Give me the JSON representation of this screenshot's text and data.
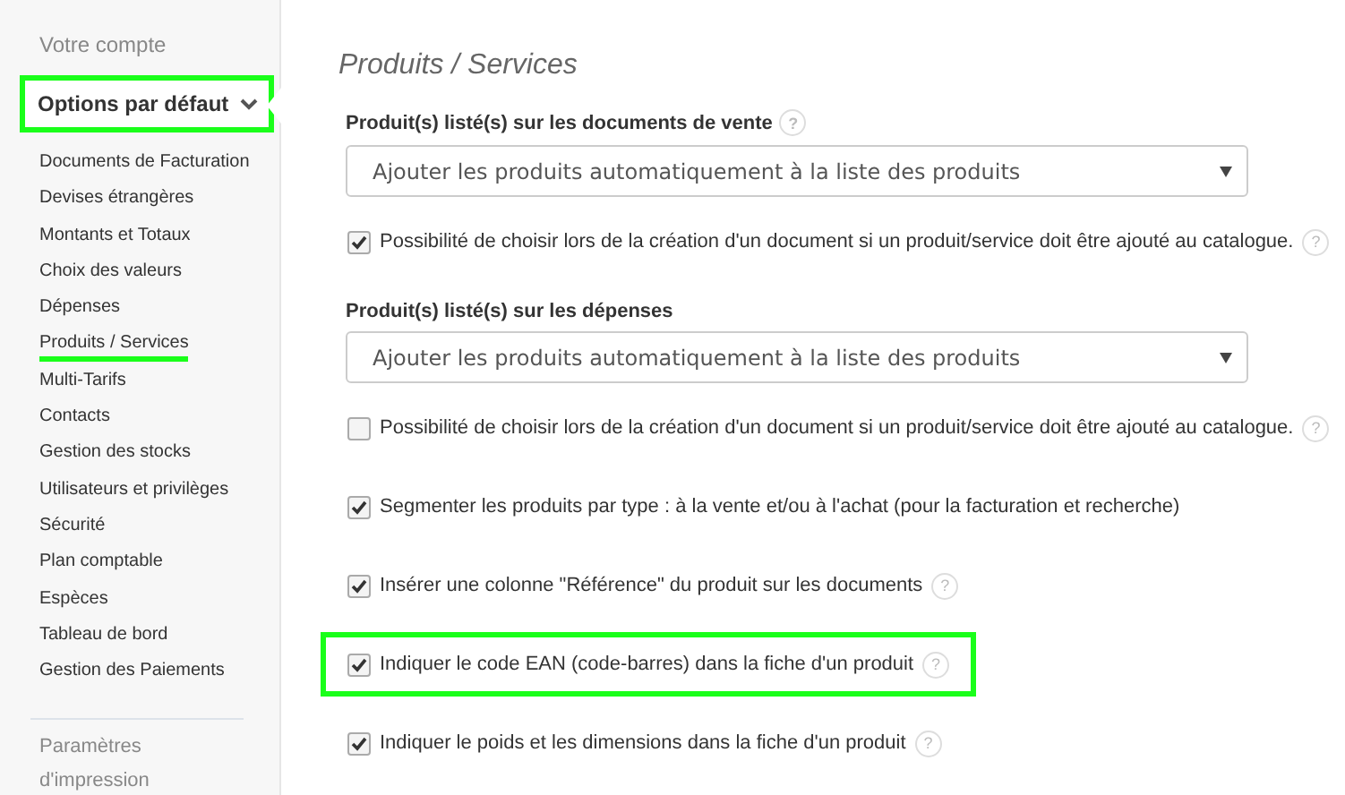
{
  "sidebar": {
    "top_link": "Votre compte",
    "section": {
      "label": "Options par défaut",
      "expanded": true,
      "highlighted": true
    },
    "items": [
      {
        "label": "Documents de Facturation",
        "selected": false
      },
      {
        "label": "Devises étrangères",
        "selected": false
      },
      {
        "label": "Montants et Totaux",
        "selected": false
      },
      {
        "label": "Choix des valeurs",
        "selected": false
      },
      {
        "label": "Dépenses",
        "selected": false
      },
      {
        "label": "Produits / Services",
        "selected": true
      },
      {
        "label": "Multi-Tarifs",
        "selected": false
      },
      {
        "label": "Contacts",
        "selected": false
      },
      {
        "label": "Gestion des stocks",
        "selected": false
      },
      {
        "label": "Utilisateurs et privilèges",
        "selected": false
      },
      {
        "label": "Sécurité",
        "selected": false
      },
      {
        "label": "Plan comptable",
        "selected": false
      },
      {
        "label": "Espèces",
        "selected": false
      },
      {
        "label": "Tableau de bord",
        "selected": false
      },
      {
        "label": "Gestion des Paiements",
        "selected": false
      }
    ],
    "bottom_link": "Paramètres d'impression"
  },
  "main": {
    "title": "Produits / Services",
    "fields": [
      {
        "kind": "select",
        "label": "Produit(s) listé(s) sur les documents de vente",
        "help": "?",
        "value": "Ajouter les produits automatiquement à la liste des produits"
      },
      {
        "kind": "checkbox",
        "label": "Possibilité de choisir lors de la création d'un document si un produit/service doit être ajouté au catalogue.",
        "checked": true,
        "help": "?",
        "highlighted": false
      },
      {
        "kind": "select",
        "label": "Produit(s) listé(s) sur les dépenses",
        "value": "Ajouter les produits automatiquement à la liste des produits"
      },
      {
        "kind": "checkbox",
        "label": "Possibilité de choisir lors de la création d'un document si un produit/service doit être ajouté au catalogue.",
        "checked": false,
        "help": "?",
        "highlighted": false
      },
      {
        "kind": "checkbox",
        "label": "Segmenter les produits par type : à la vente et/ou à l'achat (pour la facturation et recherche)",
        "checked": true,
        "highlighted": false
      },
      {
        "kind": "checkbox",
        "label": "Insérer une colonne \"Référence\" du produit sur les documents",
        "checked": true,
        "help": "?",
        "highlighted": false
      },
      {
        "kind": "checkbox",
        "label": "Indiquer le code EAN (code-barres) dans la fiche d'un produit",
        "checked": true,
        "help": "?",
        "highlighted": true
      },
      {
        "kind": "checkbox",
        "label": "Indiquer le poids et les dimensions dans la fiche d'un produit",
        "checked": true,
        "help": "?",
        "highlighted": false
      }
    ]
  }
}
